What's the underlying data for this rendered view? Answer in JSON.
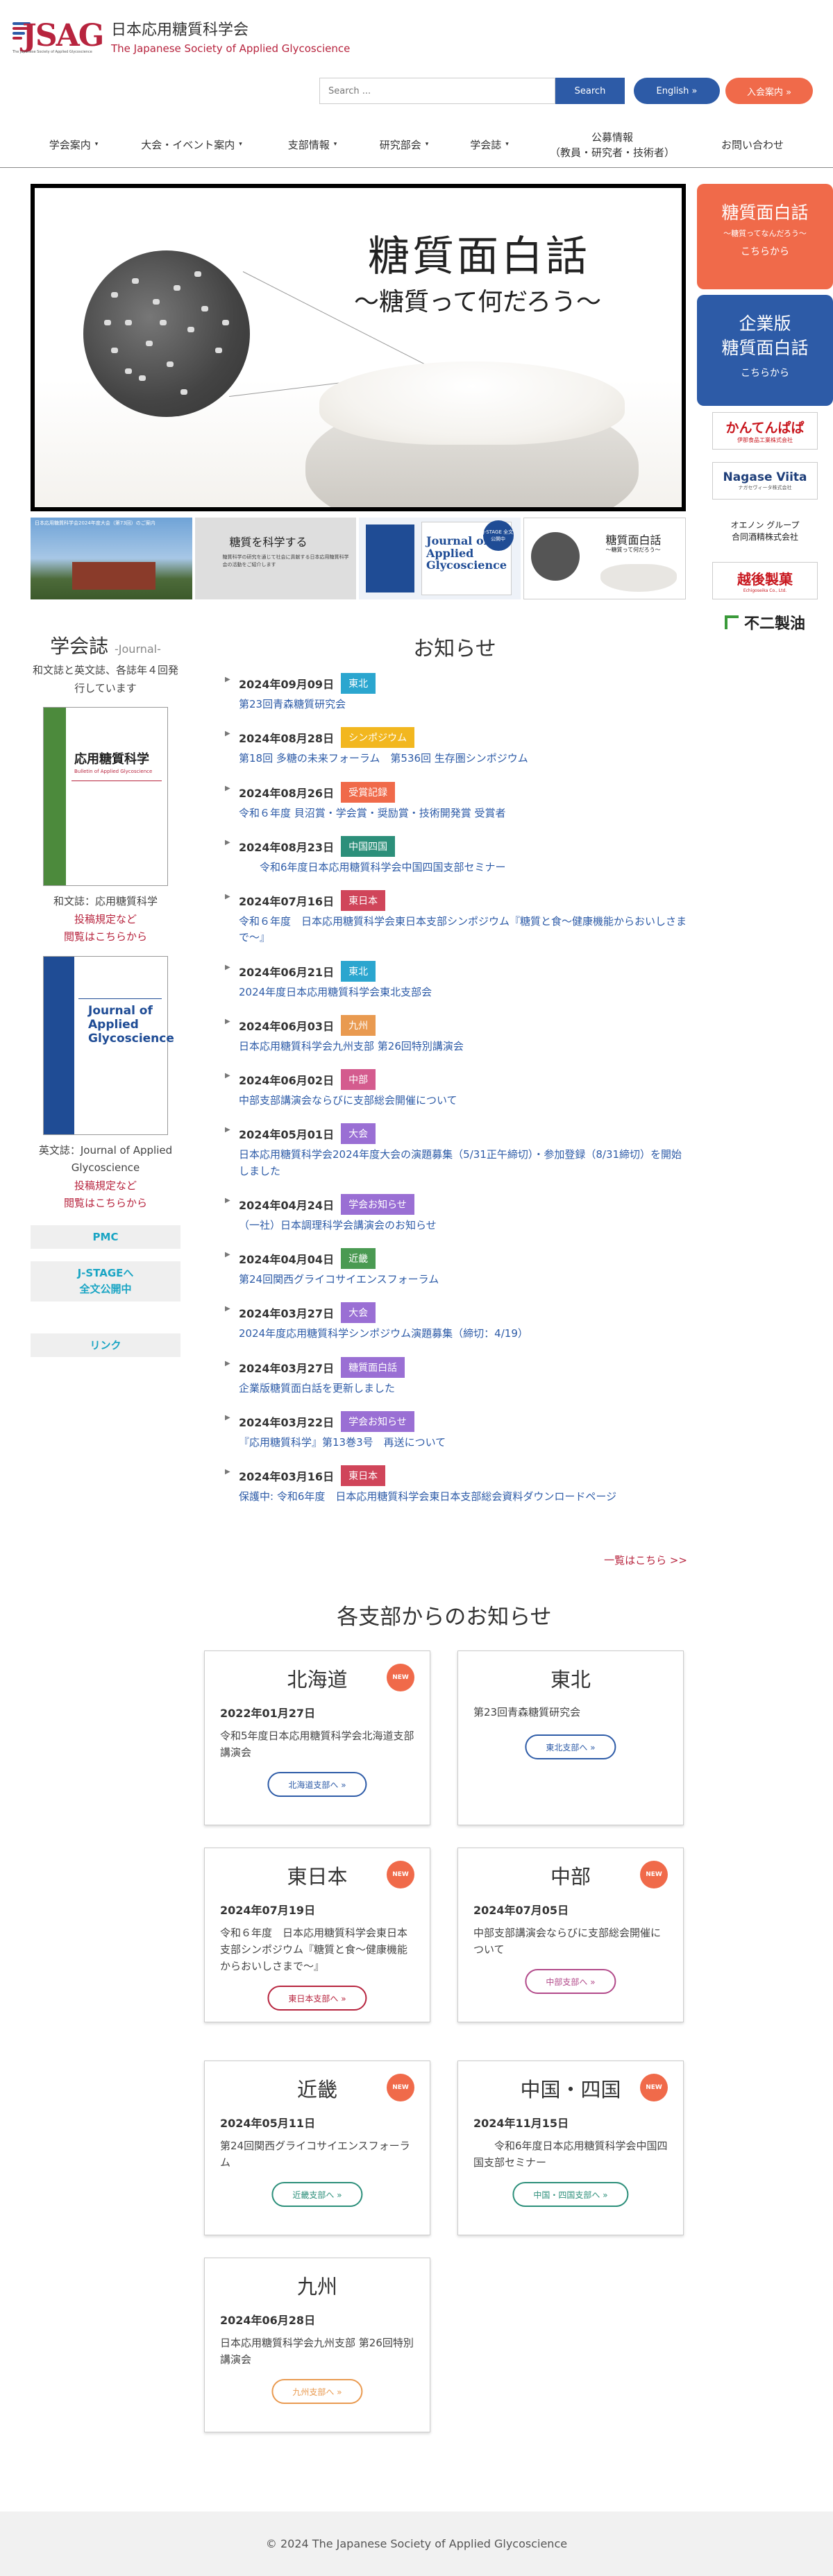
{
  "header": {
    "logo_mark": "JSAG",
    "logo_subtext": "The Japanese Society of Applied Glycoscience",
    "title_jp": "日本応用糖質科学会",
    "title_en": "The Japanese Society of Applied Glycoscience",
    "search_placeholder": "Search ...",
    "search_button": "Search",
    "english_button": "English »",
    "join_button": "入会案内 »"
  },
  "nav": [
    {
      "label": "学会案内",
      "caret": "▾"
    },
    {
      "label": "大会・イベント案内",
      "caret": "▾"
    },
    {
      "label": "支部情報",
      "caret": "▾"
    },
    {
      "label": "研究部会",
      "caret": "▾"
    },
    {
      "label": "学会誌",
      "caret": "▾"
    },
    {
      "label": "公募情報\n（教員・研究者・技術者）",
      "caret": ""
    },
    {
      "label": "お問い合わせ",
      "caret": ""
    }
  ],
  "hero": {
    "title": "糖質面白話",
    "subtitle": "〜糖質って何だろう〜"
  },
  "thumbs": {
    "t1_text": "日本応用糖質科学会2024年度大会（第73回）のご案内",
    "t2_title": "糖質を科学する",
    "t2_text": "糖質科学の研究を通じて社会に貢献する日本応用糖質科学会の活動をご紹介します",
    "t3_title": "Journal of Applied Glycoscience",
    "t3_badge": "J-STAGE 全文公開中",
    "t4_title": "糖質面白話",
    "t4_sub": "〜糖質って何だろう〜"
  },
  "promo": {
    "p1_big": "糖質面白話",
    "p1_small": "〜糖質ってなんだろう〜",
    "p1_link": "こちらから",
    "p2_big_1": "企業版",
    "p2_big_2": "糖質面白話",
    "p2_link": "こちらから"
  },
  "sponsors": [
    {
      "name": "かんてんぱぱ",
      "sub": "伊那食品工業株式会社",
      "color": "#c8161d"
    },
    {
      "name": "Nagase Viita",
      "sub": "ナガセヴィータ株式会社",
      "color": "#1f3f7a"
    },
    {
      "name": "オエノン グループ",
      "sub": "合同酒精株式会社",
      "color": "#222222"
    },
    {
      "name": "越後製菓",
      "sub": "Echigoseika Co., Ltd.",
      "color": "#c8161d"
    },
    {
      "name": "不二製油",
      "sub": "",
      "color": "#222222"
    }
  ],
  "journal": {
    "heading": "学会誌",
    "heading_en": "-Journal-",
    "desc": "和文誌と英文誌、各誌年４回発行しています",
    "jp_cover_title": "応用糖質科学",
    "jp_cover_sub": "Bulletin of Applied Glycoscience",
    "jp_caption": "和文誌：応用糖質科学",
    "jp_link1": "投稿規定など",
    "jp_link2": "閲覧はこちらから",
    "en_cover_title": "Journal of Applied Glycoscience",
    "en_caption": "英文誌：Journal of Applied Glycoscience",
    "en_link1": "投稿規定など",
    "en_link2": "閲覧はこちらから",
    "btn_pmc": " PMC",
    "btn_jstage_1": " J-STAGEへ",
    "btn_jstage_2": "全文公開中",
    "btn_link": " リンク"
  },
  "news": {
    "title": "お知らせ",
    "more": "一覧はこちら >>",
    "items": [
      {
        "date": "2024年09月09日",
        "tag": "東北",
        "color": "#2ba6cf",
        "text": "第23回青森糖質研究会"
      },
      {
        "date": "2024年08月28日",
        "tag": "シンポジウム",
        "color": "#f2b71f",
        "text": "第18回 多糖の未来フォーラム　第536回 生存圏シンポジウム"
      },
      {
        "date": "2024年08月26日",
        "tag": "受賞記録",
        "color": "#f06a4a",
        "text": "令和６年度 貝沼賞・学会賞・奨励賞・技術開発賞 受賞者"
      },
      {
        "date": "2024年08月23日",
        "tag": "中国四国",
        "color": "#2c8f7a",
        "text": "　　令和6年度日本応用糖質科学会中国四国支部セミナー"
      },
      {
        "date": "2024年07月16日",
        "tag": "東日本",
        "color": "#d0455a",
        "text": "令和６年度　日本応用糖質科学会東日本支部シンポジウム『糖質と食〜健康機能からおいしさまで〜』"
      },
      {
        "date": "2024年06月21日",
        "tag": "東北",
        "color": "#2ba6cf",
        "text": "2024年度日本応用糖質科学会東北支部会"
      },
      {
        "date": "2024年06月03日",
        "tag": "九州",
        "color": "#e99a50",
        "text": "日本応用糖質科学会九州支部 第26回特別講演会"
      },
      {
        "date": "2024年06月02日",
        "tag": "中部",
        "color": "#d45b8e",
        "text": "中部支部講演会ならびに支部総会開催について"
      },
      {
        "date": "2024年05月01日",
        "tag": "大会",
        "color": "#9a6fd4",
        "text": "日本応用糖質科学会2024年度大会の演題募集（5/31正午締切）・参加登録（8/31締切）を開始しました"
      },
      {
        "date": "2024年04月24日",
        "tag": "学会お知らせ",
        "color": "#9a6fd4",
        "text": "（一社）日本調理科学会講演会のお知らせ"
      },
      {
        "date": "2024年04月04日",
        "tag": "近畿",
        "color": "#4a9a52",
        "text": "第24回関西グライコサイエンスフォーラム"
      },
      {
        "date": "2024年03月27日",
        "tag": "大会",
        "color": "#9a6fd4",
        "text": "2024年度応用糖質科学シンポジウム演題募集（締切：4/19）"
      },
      {
        "date": "2024年03月27日",
        "tag": "糖質面白話",
        "color": "#9a6fd4",
        "text": "企業版糖質面白話を更新しました"
      },
      {
        "date": "2024年03月22日",
        "tag": "学会お知らせ",
        "color": "#9a6fd4",
        "text": "『応用糖質科学』第13巻3号　再送について"
      },
      {
        "date": "2024年03月16日",
        "tag": "東日本",
        "color": "#d0455a",
        "text": "保護中: 令和6年度　日本応用糖質科学会東日本支部総会資料ダウンロードページ"
      }
    ]
  },
  "branches": {
    "title": "各支部からのお知らせ",
    "new_label": "NEW",
    "cards": [
      {
        "name": "北海道",
        "new": true,
        "date": "2022年01月27日",
        "text": "令和5年度日本応用糖質科学会北海道支部講演会",
        "btn": "北海道支部へ »",
        "color": "#2d5ba7"
      },
      {
        "name": "東北",
        "new": false,
        "date": "",
        "text": "第23回青森糖質研究会",
        "btn": "東北支部へ »",
        "color": "#2d5ba7"
      },
      {
        "name": "東日本",
        "new": true,
        "date": "2024年07月19日",
        "text": "令和６年度　日本応用糖質科学会東日本支部シンポジウム『糖質と食〜健康機能からおいしさまで〜』",
        "btn": "東日本支部へ »",
        "color": "#b7243e"
      },
      {
        "name": "中部",
        "new": true,
        "date": "2024年07月05日",
        "text": "中部支部講演会ならびに支部総会開催について",
        "btn": "中部支部へ »",
        "color": "#b24a8a"
      },
      {
        "name": "近畿",
        "new": true,
        "date": "2024年05月11日",
        "text": "第24回関西グライコサイエンスフォーラム",
        "btn": "近畿支部へ »",
        "color": "#2c8f7a"
      },
      {
        "name": "中国・四国",
        "new": true,
        "date": "2024年11月15日",
        "text": "　　令和6年度日本応用糖質科学会中国四国支部セミナー",
        "btn": "中国・四国支部へ »",
        "color": "#2c8f7a"
      },
      {
        "name": "九州",
        "new": false,
        "date": "2024年06月28日",
        "text": "日本応用糖質科学会九州支部 第26回特別講演会",
        "btn": "九州支部へ »",
        "color": "#e99a50"
      }
    ]
  },
  "footer": {
    "copyright": "© 2024 The Japanese Society of Applied Glycoscience"
  }
}
